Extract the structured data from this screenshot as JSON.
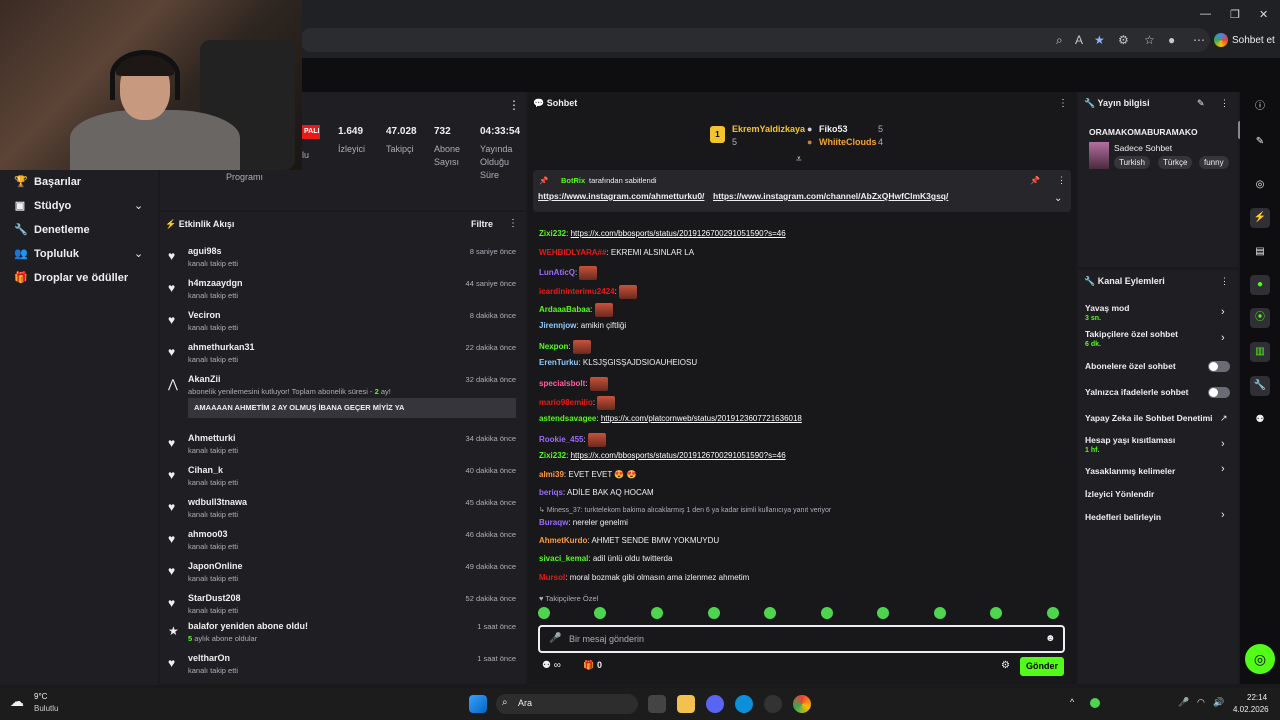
{
  "browser": {
    "sohbet_et": "Sohbet et"
  },
  "nav": {
    "items": [
      {
        "label": "Başarılar",
        "icon": "trophy-icon"
      },
      {
        "label": "Stüdyo",
        "icon": "studio-icon"
      },
      {
        "label": "Denetleme",
        "icon": "wrench-icon"
      },
      {
        "label": "Topluluk",
        "icon": "users-icon"
      },
      {
        "label": "Droplar ve ödüller",
        "icon": "gift-icon"
      }
    ]
  },
  "stats": {
    "badge": "PALI",
    "lu": "lu",
    "viewers": {
      "value": "1.649",
      "label": "İzleyici"
    },
    "followers": {
      "value": "47.028",
      "label": "Takipçi"
    },
    "subs": {
      "value": "732",
      "label1": "Abone",
      "label2": "Sayısı"
    },
    "uptime": {
      "value": "04:33:54",
      "label1": "Yayında",
      "label2": "Olduğu",
      "label3": "Süre"
    },
    "program": "Programı"
  },
  "activity": {
    "title": "Etkinlik Akışı",
    "filter": "Filtre",
    "items": [
      {
        "name": "agui98s",
        "sub": "kanalı takip etti",
        "time": "8 saniye önce"
      },
      {
        "name": "h4mzaaydgn",
        "sub": "kanalı takip etti",
        "time": "44 saniye önce"
      },
      {
        "name": "Veciron",
        "sub": "kanalı takip etti",
        "time": "8 dakika önce"
      },
      {
        "name": "ahmethurkan31",
        "sub": "kanalı takip etti",
        "time": "22 dakika önce"
      },
      {
        "name": "AkanZii",
        "sub_pre": "abonelik yenilemesini kutluyor! Toplam abonelik süresi - ",
        "sub_num": "2",
        "sub_post": " ay!",
        "time": "32 dakika önce",
        "message": "AMAAAAN AHMETİM 2 AY OLMUŞ İBANA GEÇER MİYİZ YA"
      },
      {
        "name": "Ahmetturki",
        "sub": "kanalı takip etti",
        "time": "34 dakika önce"
      },
      {
        "name": "Cihan_k",
        "sub": "kanalı takip etti",
        "time": "40 dakika önce"
      },
      {
        "name": "wdbull3tnawa",
        "sub": "kanalı takip etti",
        "time": "45 dakika önce"
      },
      {
        "name": "ahmoo03",
        "sub": "kanalı takip etti",
        "time": "46 dakika önce"
      },
      {
        "name": "JaponOnline",
        "sub": "kanalı takip etti",
        "time": "49 dakika önce"
      },
      {
        "name": "StarDust208",
        "sub": "kanalı takip etti",
        "time": "52 dakika önce"
      },
      {
        "name": "balafor yeniden abone oldu!",
        "sub_num": "5",
        "sub": " aylık abone oldular",
        "time": "1 saat önce"
      },
      {
        "name": "veltharOn",
        "sub": "kanalı takip etti",
        "time": "1 saat önce"
      }
    ]
  },
  "chat": {
    "title": "Sohbet",
    "leaders": [
      {
        "rank": "1",
        "name": "EkremYaldizkaya",
        "count": "5"
      },
      {
        "name": "Fiko53",
        "count": "5"
      },
      {
        "name": "WhiiteClouds",
        "count": "4"
      }
    ],
    "pinned": {
      "by_name": "BotRix",
      "by_text": " tarafından sabitlendi",
      "link1": "https://www.instagram.com/ahmetturku0/",
      "link2": "https://www.instagram.com/channel/AbZxQHwfClmK3gsq/"
    },
    "messages": [
      {
        "user": "Zixi232",
        "color": "#53fc18",
        "link": "https://x.com/bbosports/status/2019126700291051590?s=46"
      },
      {
        "user": "WEHBIDLYARA##",
        "color": "#e91916",
        "text": "EKREMI ALSINLAR LA"
      },
      {
        "user": "LunAticQ",
        "color": "#9b6bff",
        "emote": true
      },
      {
        "user": "icardininterimu2424",
        "color": "#e91916",
        "emote": true
      },
      {
        "user": "ArdaaaBabaa",
        "color": "#53fc18",
        "emote": true
      },
      {
        "user": "Jirennjow",
        "color": "#8ecbff",
        "text": "amikin çiftliği"
      },
      {
        "user": "Nexpon",
        "color": "#53fc18",
        "emote": true
      },
      {
        "user": "ErenTurku",
        "color": "#8ecbff",
        "text": "KLSJŞGISŞAJDSIOAUHEIOSU"
      },
      {
        "user": "specialsbolt",
        "color": "#ff5fa2",
        "emote": true
      },
      {
        "user": "mario98emilio",
        "color": "#e91916",
        "emote": true
      },
      {
        "user": "astendsavagee",
        "color": "#53fc18",
        "link": "https://x.com/platcornweb/status/2019123607721636018"
      },
      {
        "user": "Rookie_455",
        "color": "#9b6bff",
        "emote": true
      },
      {
        "user": "Zixi232",
        "color": "#53fc18",
        "link": "https://x.com/bbosports/status/2019126700291051590?s=46"
      },
      {
        "user": "almi39",
        "color": "#ff9b3d",
        "text": "EVET EVET 😍 😍"
      },
      {
        "user": "beriqs",
        "color": "#9b6bff",
        "text": "ADİLE BAK AQ HOCAM"
      },
      {
        "reply": "Miness_37: turktelekom bakima alıcaklarmış 1 den 6 ya kadar isimli kullanıcıya yanıt veriyor",
        "user": "Buraqw",
        "color": "#9b6bff",
        "text": "nereler genelmi"
      },
      {
        "user": "AhmetKurdo",
        "color": "#ff9b3d",
        "text": "AHMET SENDE BMW YOKMUYDU"
      },
      {
        "user": "sivaci_kemal",
        "color": "#53fc18",
        "text": "adil ünlü oldu twitterda"
      },
      {
        "user": "Mursol",
        "color": "#e91916",
        "text": "moral bozmak gibi olmasın ama izlenmez ahmetim"
      }
    ],
    "followers_only": "Takipçilere Özel",
    "input_placeholder": "Bir mesaj gönderin",
    "points": "0",
    "send": "Gönder"
  },
  "stream_info": {
    "title": "Yayın bilgisi",
    "stream_title": "ORAMAKOMABURAMAKO",
    "category": "Sadece Sohbet",
    "tags": [
      "Turkish",
      "Türkçe",
      "funny"
    ]
  },
  "channel_actions": {
    "title": "Kanal Eylemleri",
    "items": [
      {
        "label": "Yavaş mod",
        "sub": "3 sn."
      },
      {
        "label": "Takipçilere özel sohbet",
        "sub": "6 dk."
      },
      {
        "label": "Abonelere özel sohbet"
      },
      {
        "label": "Yalnızca ifadelerle sohbet"
      },
      {
        "label": "Yapay Zeka ile Sohbet Denetimi"
      },
      {
        "label": "Hesap yaşı kısıtlaması",
        "sub": "1 hf."
      },
      {
        "label": "Yasaklanmış kelimeler"
      },
      {
        "label": "İzleyici Yönlendir"
      },
      {
        "label": "Hedefleri belirleyin"
      }
    ]
  },
  "taskbar": {
    "weather_temp": "9°C",
    "weather_desc": "Bulutlu",
    "search": "Ara",
    "time": "22:14",
    "date": "4.02.2026"
  },
  "colors": {
    "accent": "#53fc18",
    "panel": "#1f1f23",
    "chat_bg": "#18181b"
  }
}
